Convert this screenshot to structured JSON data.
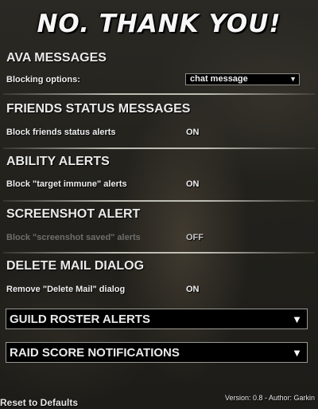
{
  "title": "NO. THANK YOU!",
  "sections": [
    {
      "header": "AVA MESSAGES",
      "row": {
        "label": "Blocking options:",
        "dropdown_value": "chat message",
        "dropdown_arrow": "▼"
      }
    },
    {
      "header": "FRIENDS STATUS MESSAGES",
      "row": {
        "label": "Block friends status alerts",
        "value": "ON"
      }
    },
    {
      "header": "ABILITY ALERTS",
      "row": {
        "label": "Block \"target immune\" alerts",
        "value": "ON"
      }
    },
    {
      "header": "SCREENSHOT ALERT",
      "row": {
        "label": "Block \"screenshot saved\" alerts",
        "value": "OFF",
        "disabled": true
      }
    },
    {
      "header": "DELETE MAIL DIALOG",
      "row": {
        "label": "Remove \"Delete Mail\" dialog",
        "value": "ON"
      }
    }
  ],
  "collapsed": [
    {
      "label": "GUILD ROSTER ALERTS",
      "arrow": "▼"
    },
    {
      "label": "RAID SCORE NOTIFICATIONS",
      "arrow": "▼"
    }
  ],
  "footer": {
    "reset": "Reset to Defaults",
    "version": "Version: 0.8  -  Author: Garkin"
  },
  "colors": {
    "text": "#f0f0f0",
    "disabled_text": "#6e6e6a",
    "dropdown_bg": "#000000",
    "separator": "#d7d7cd"
  }
}
